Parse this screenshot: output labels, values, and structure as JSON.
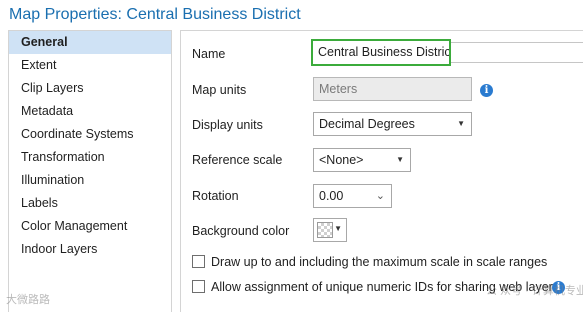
{
  "window": {
    "title": "Map Properties: Central Business District"
  },
  "sidebar": {
    "items": [
      {
        "label": "General",
        "active": true
      },
      {
        "label": "Extent"
      },
      {
        "label": "Clip Layers"
      },
      {
        "label": "Metadata"
      },
      {
        "label": "Coordinate Systems"
      },
      {
        "label": "Transformation"
      },
      {
        "label": "Illumination"
      },
      {
        "label": "Labels"
      },
      {
        "label": "Color Management"
      },
      {
        "label": "Indoor Layers"
      }
    ]
  },
  "general": {
    "name_label": "Name",
    "name_value": "Central Business District",
    "map_units_label": "Map units",
    "map_units_value": "Meters",
    "display_units_label": "Display units",
    "display_units_value": "Decimal Degrees",
    "reference_scale_label": "Reference scale",
    "reference_scale_value": "<None>",
    "rotation_label": "Rotation",
    "rotation_value": "0.00",
    "background_color_label": "Background color",
    "checkbox_max_scale_label": "Draw up to and including the maximum scale in scale ranges",
    "checkbox_max_scale_checked": false,
    "checkbox_unique_ids_label": "Allow assignment of unique numeric IDs for sharing web layers",
    "checkbox_unique_ids_checked": false
  },
  "watermark": {
    "left": "大微路路",
    "right": "公 众号 · 计算机专业"
  },
  "colors": {
    "accent": "#1a6fb0",
    "focus_border": "#3bab3b",
    "selected_bg": "#cfe2f5",
    "info_icon": "#2a7bd0"
  }
}
